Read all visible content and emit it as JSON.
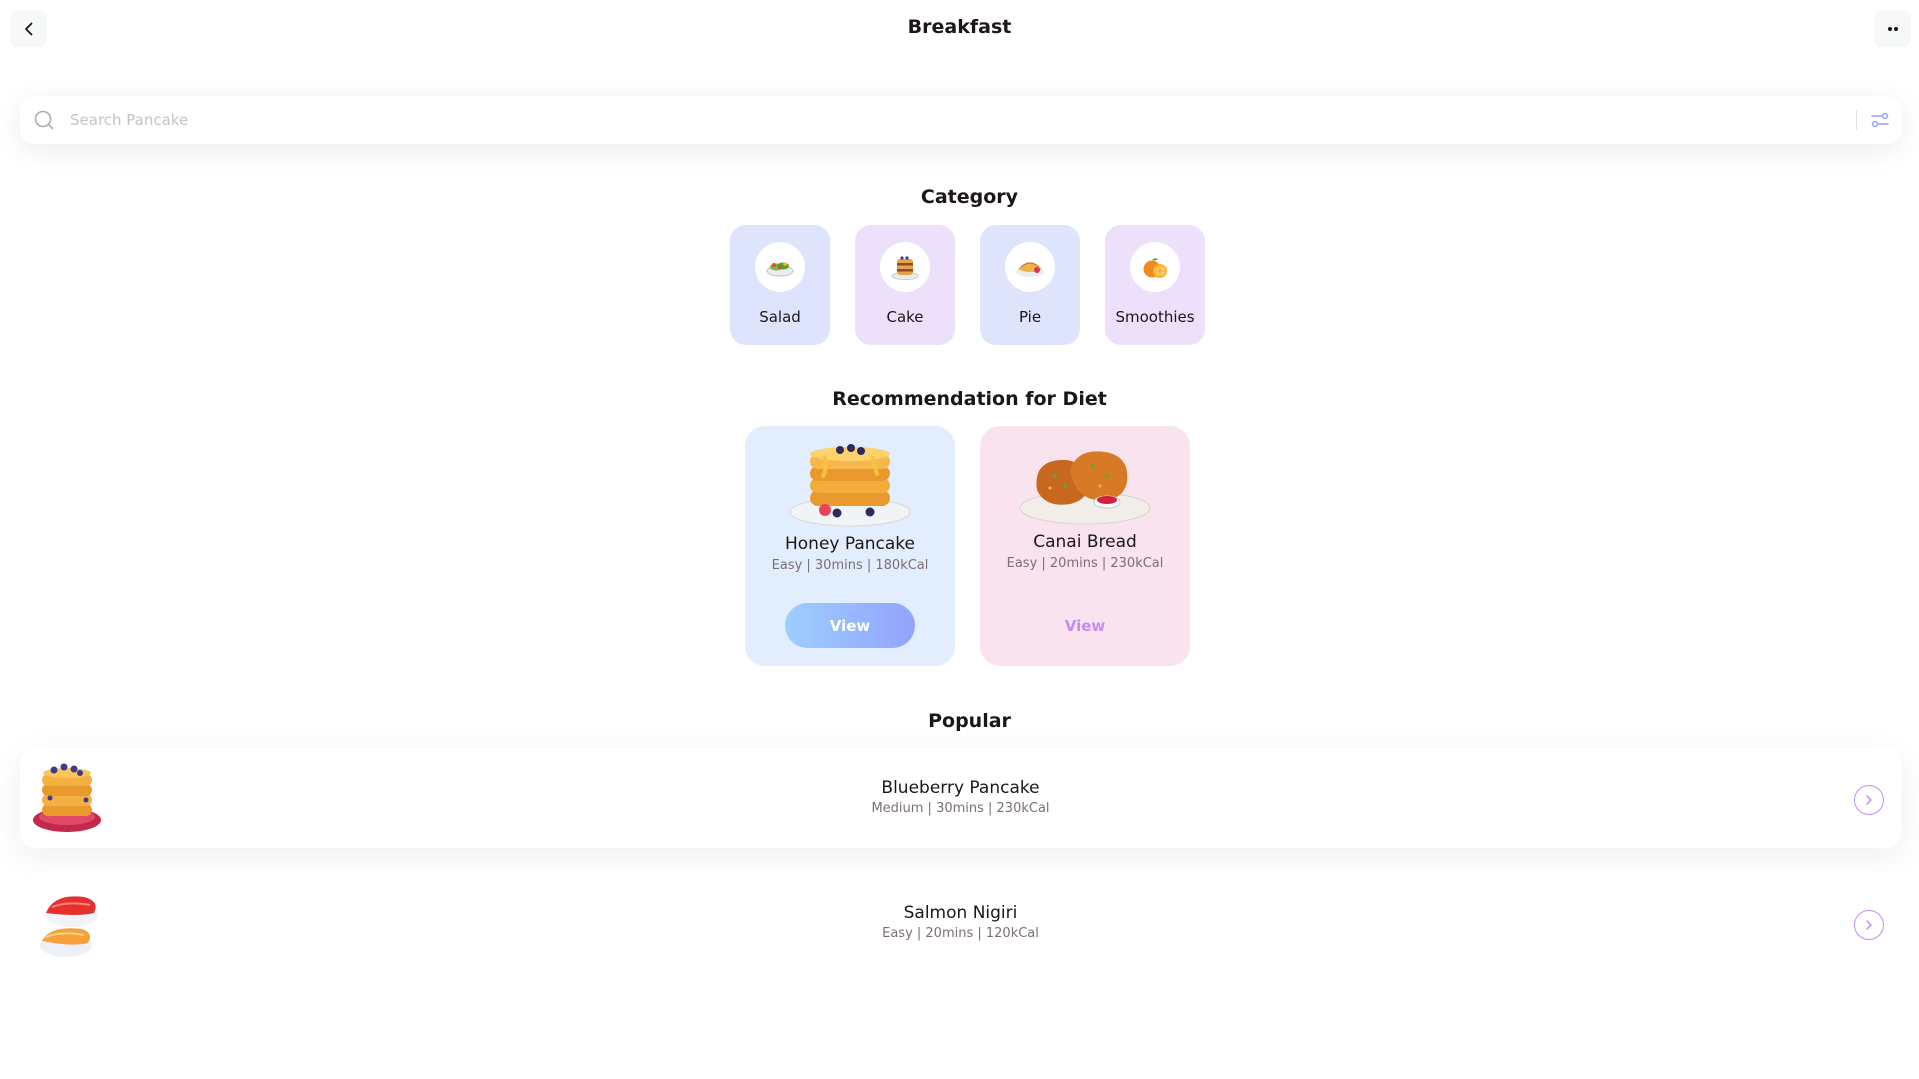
{
  "header": {
    "title": "Breakfast"
  },
  "search": {
    "placeholder": "Search Pancake",
    "value": ""
  },
  "category": {
    "title": "Category",
    "items": [
      {
        "label": "Salad",
        "icon": "salad-icon",
        "bg": "#dde4fc"
      },
      {
        "label": "Cake",
        "icon": "cake-icon",
        "bg": "#ece0fb"
      },
      {
        "label": "Pie",
        "icon": "pie-icon",
        "bg": "#dde4fc"
      },
      {
        "label": "Smoothies",
        "icon": "orange-icon",
        "bg": "#ece0fb"
      }
    ]
  },
  "recommendation": {
    "title": "Recommendation for Diet",
    "items": [
      {
        "name": "Honey Pancake",
        "meta": "Easy | 30mins | 180kCal",
        "view_label": "View",
        "bg": "#e2edfe",
        "image": "honey-pancake-image"
      },
      {
        "name": "Canai Bread",
        "meta": "Easy | 20mins | 230kCal",
        "view_label": "View",
        "bg": "#f9e3ef",
        "image": "canai-bread-image"
      }
    ]
  },
  "popular": {
    "title": "Popular",
    "items": [
      {
        "name": "Blueberry Pancake",
        "meta": "Medium | 30mins | 230kCal",
        "image": "blueberry-pancake-image"
      },
      {
        "name": "Salmon Nigiri",
        "meta": "Easy | 20mins | 120kCal",
        "image": "salmon-nigiri-image"
      }
    ]
  },
  "colors": {
    "text": "#1d1617",
    "muted": "#7b6f72",
    "accent_blue": "#92a3fd",
    "accent_purple": "#c58bf2"
  }
}
